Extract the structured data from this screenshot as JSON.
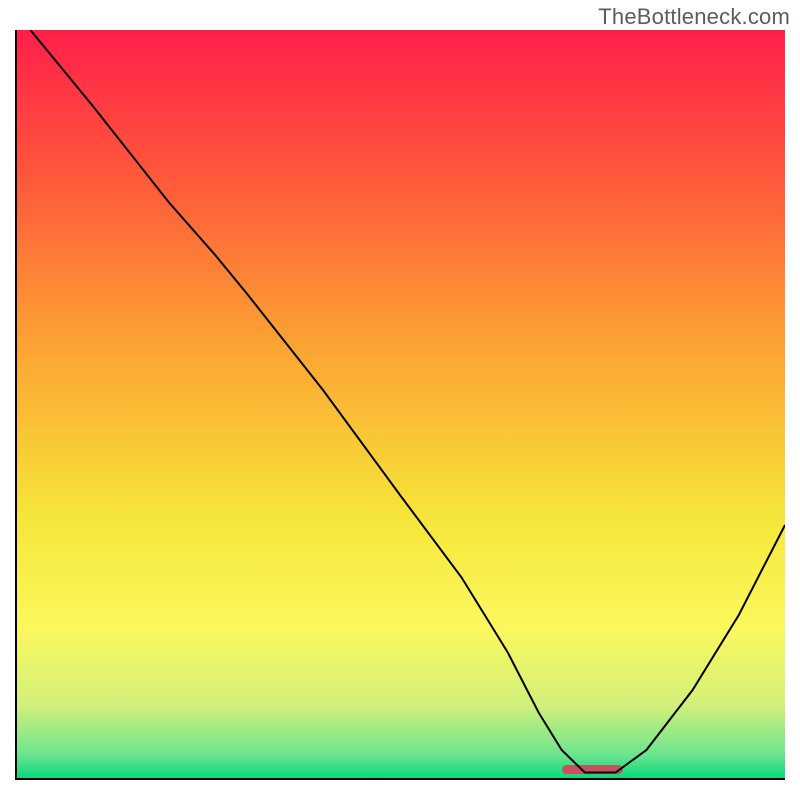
{
  "watermark": "TheBottleneck.com",
  "chart_data": {
    "type": "line",
    "title": "",
    "xlabel": "",
    "ylabel": "",
    "xlim": [
      0,
      100
    ],
    "ylim": [
      0,
      100
    ],
    "grid": false,
    "legend": false,
    "annotations": [],
    "gradient_stops": [
      {
        "pos": 0.0,
        "color": "#ff1f4a"
      },
      {
        "pos": 0.2,
        "color": "#ff593b"
      },
      {
        "pos": 0.42,
        "color": "#fca332"
      },
      {
        "pos": 0.65,
        "color": "#f6e63a"
      },
      {
        "pos": 0.8,
        "color": "#fbf85e"
      },
      {
        "pos": 0.9,
        "color": "#d2f07a"
      },
      {
        "pos": 0.965,
        "color": "#6fe58f"
      },
      {
        "pos": 1.0,
        "color": "#00d87b"
      }
    ],
    "series": [
      {
        "name": "bottleneck-curve",
        "x": [
          2,
          10,
          20,
          26,
          30,
          40,
          50,
          58,
          64,
          68,
          71,
          74,
          78,
          82,
          88,
          94,
          100
        ],
        "y": [
          100,
          90,
          77,
          70,
          65,
          52,
          38,
          27,
          17,
          9,
          4,
          1,
          1,
          4,
          12,
          22,
          34
        ]
      }
    ],
    "marker": {
      "x_center": 75,
      "width_pct": 8,
      "y": 0.8,
      "height_pct": 1.2,
      "color": "#c9515f"
    }
  }
}
